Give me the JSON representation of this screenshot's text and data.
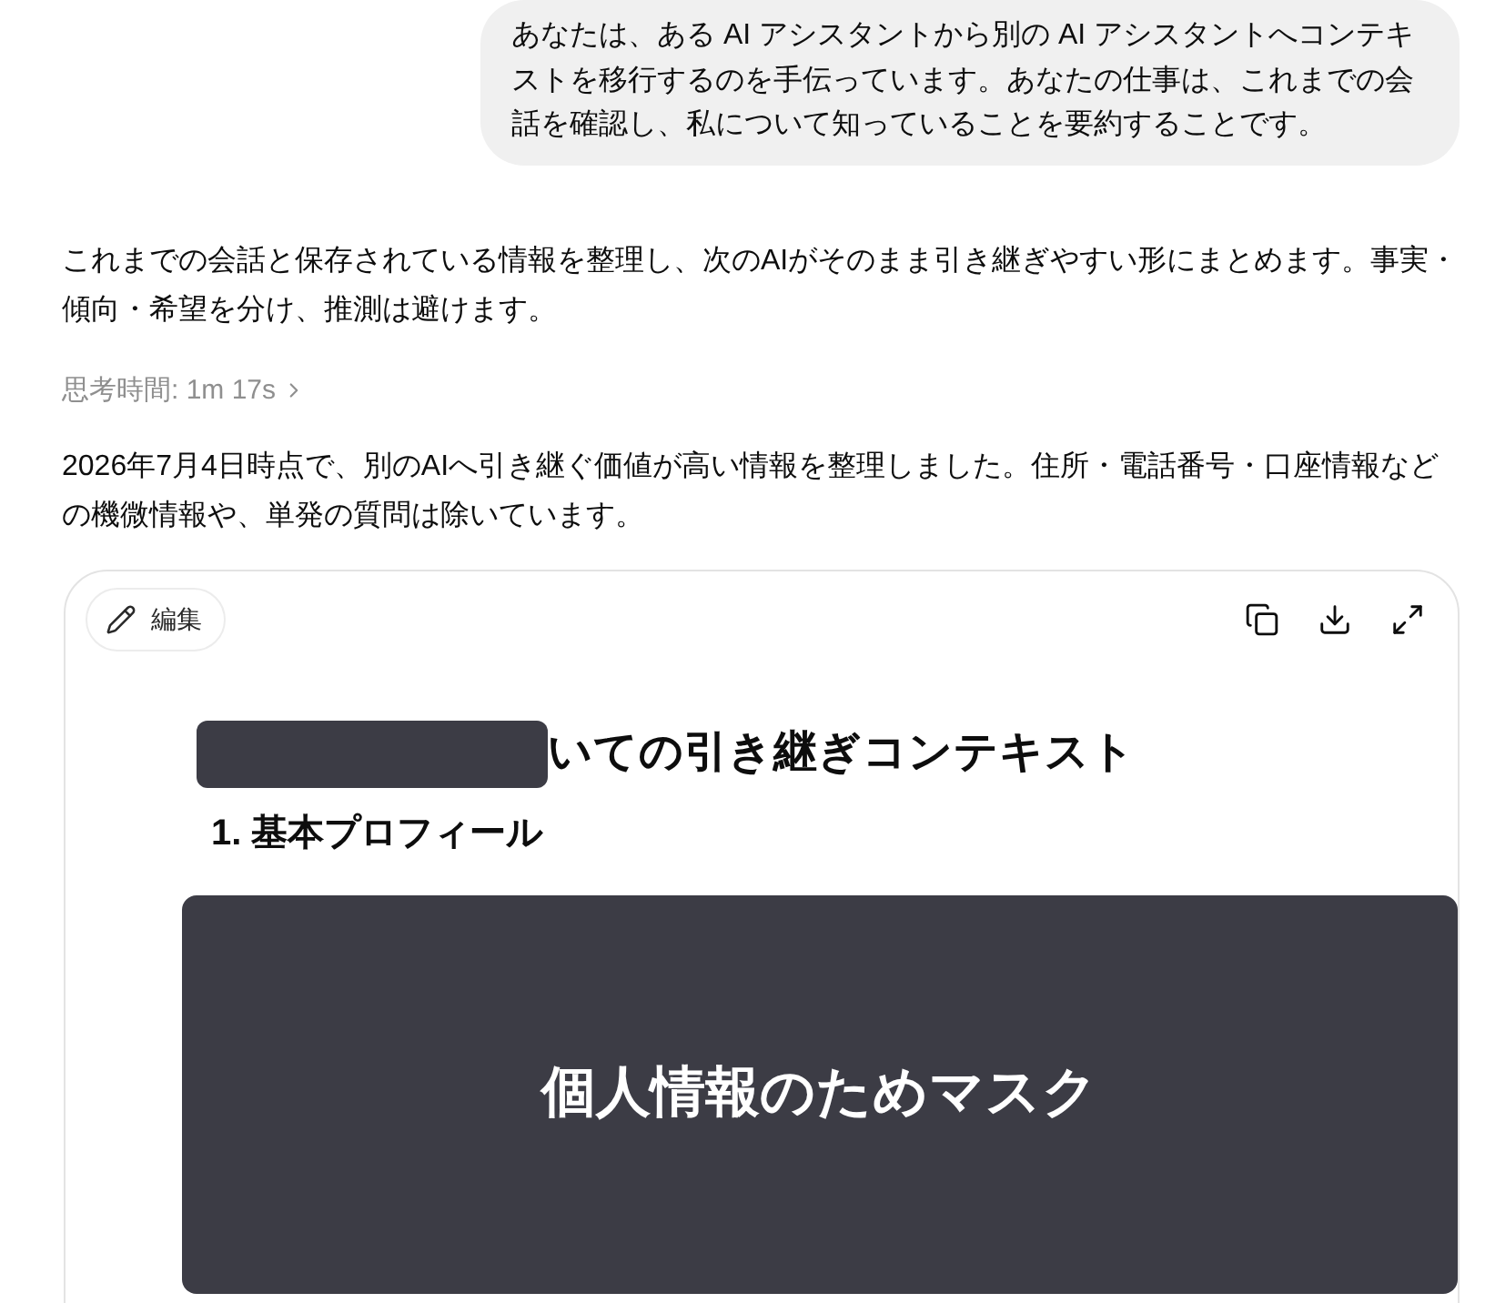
{
  "user_message": {
    "text": "あなたは、ある AI アシスタントから別の AI アシスタントへコンテキストを移行するのを手伝っています。あなたの仕事は、これまでの会話を確認し、私について知っていることを要約することです。"
  },
  "assistant": {
    "intro": "これまでの会話と保存されている情報を整理し、次のAIがそのまま引き継ぎやすい形にまとめます。事実・傾向・希望を分け、推測は避けます。",
    "thinking": {
      "label": "思考時間: 1m 17s",
      "expanded": false
    },
    "summary": "2026年7月4日時点で、別のAIへ引き継ぐ価値が高い情報を整理しました。住所・電話番号・口座情報などの機微情報や、単発の質問は除いています。"
  },
  "document": {
    "edit_button": "編集",
    "title": "いての引き継ぎコンテキスト",
    "section_heading": "1. 基本プロフィール",
    "mask_label": "個人情報のためマスク"
  }
}
